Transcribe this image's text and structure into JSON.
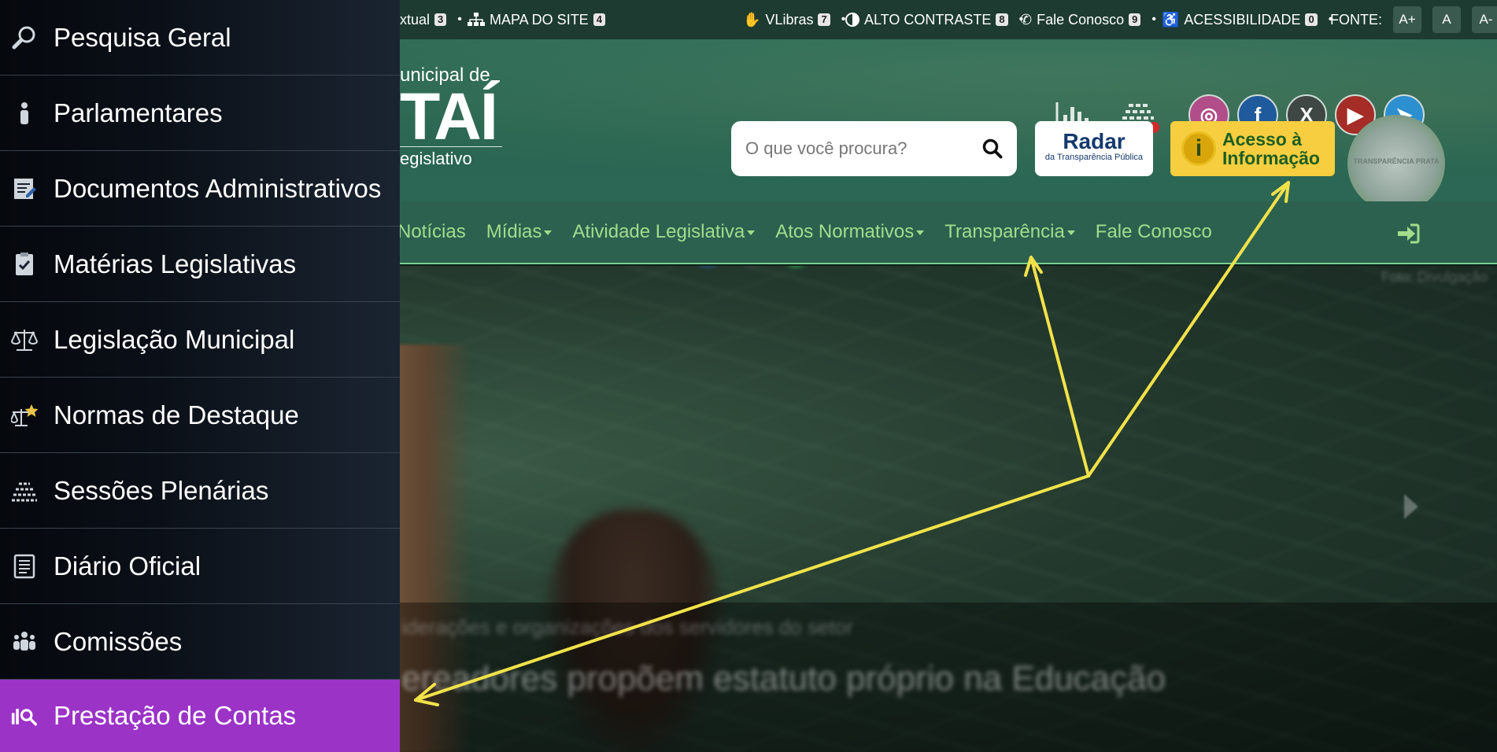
{
  "topbar": {
    "items": [
      {
        "label": "xtual",
        "key": "3"
      },
      {
        "label": "MAPA DO SITE",
        "key": "4"
      },
      {
        "label": "VLibras",
        "key": "7"
      },
      {
        "label": "ALTO CONTRASTE",
        "key": "8"
      },
      {
        "label": "Fale Conosco",
        "key": "9"
      },
      {
        "label": "ACESSIBILIDADE",
        "key": "0"
      }
    ],
    "font_label": "FONTE:",
    "font_buttons": [
      "A+",
      "A",
      "A-"
    ]
  },
  "brand": {
    "line1": "unicipal de",
    "line2": "TAÍ",
    "line3": "egislativo"
  },
  "search": {
    "placeholder": "O que você procura?"
  },
  "radar": {
    "title": "Radar",
    "subtitle": "da Transparência Pública"
  },
  "acesso": {
    "icon_letter": "i",
    "line1": "Acesso à",
    "line2": "Informação"
  },
  "seal": {
    "text": "TRANSPARÊNCIA PRATA"
  },
  "header_icons": [
    "statistics-icon",
    "plenary-icon"
  ],
  "social": [
    {
      "name": "instagram-icon",
      "glyph": "◎",
      "color": "#b14d88"
    },
    {
      "name": "facebook-icon",
      "glyph": "f",
      "color": "#1f5a9c"
    },
    {
      "name": "x-icon",
      "glyph": "X",
      "color": "#3e4744"
    },
    {
      "name": "youtube-icon",
      "glyph": "▶",
      "color": "#a52c27"
    },
    {
      "name": "telegram-icon",
      "glyph": "➤",
      "color": "#2c8fd0"
    }
  ],
  "nav": {
    "items": [
      {
        "label": "Notícias",
        "dropdown": false
      },
      {
        "label": "Mídias",
        "dropdown": true
      },
      {
        "label": "Atividade Legislativa",
        "dropdown": true
      },
      {
        "label": "Atos Normativos",
        "dropdown": true
      },
      {
        "label": "Transparência",
        "dropdown": true
      },
      {
        "label": "Fale Conosco",
        "dropdown": false
      }
    ]
  },
  "hero": {
    "subtitle": "iderações e organizações dos servidores do setor",
    "headline": "ereadores propõem estatuto próprio na Educação",
    "credit": "Foto: Divulgação"
  },
  "sidebar": {
    "items": [
      {
        "label": "Pesquisa Geral",
        "icon": "search-icon"
      },
      {
        "label": "Parlamentares",
        "icon": "person-icon"
      },
      {
        "label": "Documentos Administrativos",
        "icon": "document-edit-icon"
      },
      {
        "label": "Matérias Legislativas",
        "icon": "checklist-icon"
      },
      {
        "label": "Legislação Municipal",
        "icon": "scales-icon"
      },
      {
        "label": "Normas de Destaque",
        "icon": "scales-star-icon"
      },
      {
        "label": "Sessões Plenárias",
        "icon": "plenary-icon"
      },
      {
        "label": "Diário Oficial",
        "icon": "newspaper-icon"
      },
      {
        "label": "Comissões",
        "icon": "group-icon"
      },
      {
        "label": "Prestação de Contas",
        "icon": "accounts-search-icon",
        "active": true
      }
    ]
  },
  "colors": {
    "nav_text": "#a2dd8b",
    "active_menu": "#9b33c7",
    "arrow": "#f2e24a"
  }
}
